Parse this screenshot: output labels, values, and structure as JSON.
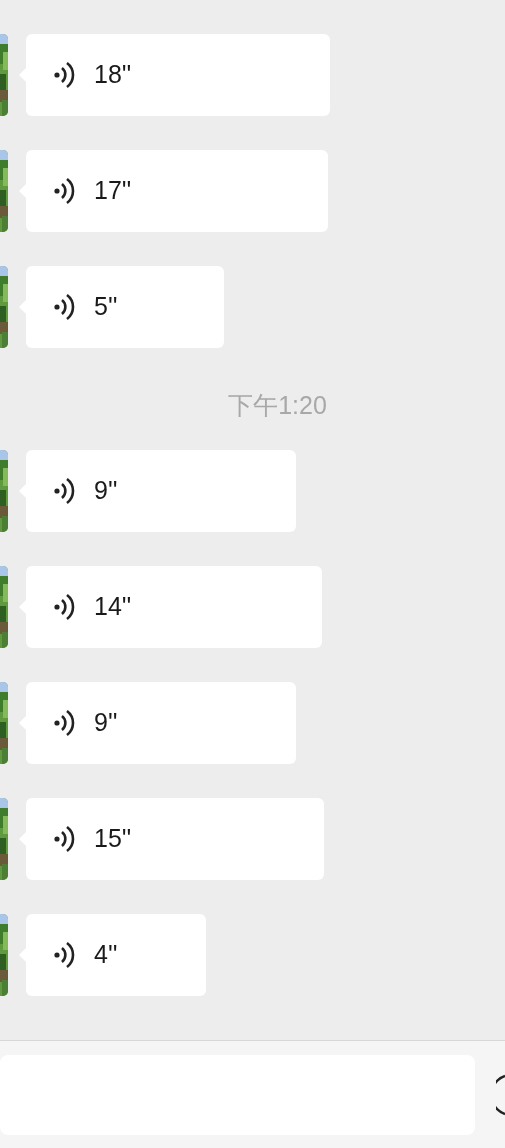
{
  "messages": [
    {
      "kind": "voice",
      "duration": "18''"
    },
    {
      "kind": "voice",
      "duration": "17''"
    },
    {
      "kind": "voice",
      "duration": "5''"
    },
    {
      "kind": "time",
      "text": "下午1:20"
    },
    {
      "kind": "voice",
      "duration": "9''"
    },
    {
      "kind": "voice",
      "duration": "14''"
    },
    {
      "kind": "voice",
      "duration": "9''"
    },
    {
      "kind": "voice",
      "duration": "15''"
    },
    {
      "kind": "voice",
      "duration": "4''"
    }
  ]
}
